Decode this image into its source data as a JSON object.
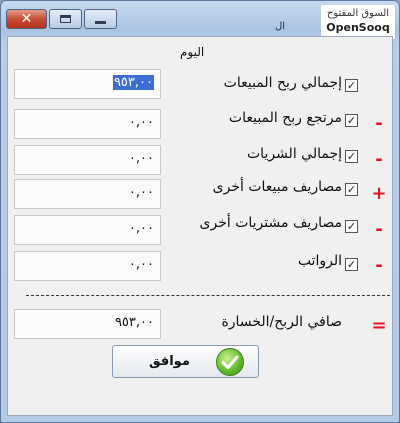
{
  "window": {
    "title": "ال"
  },
  "watermark": {
    "arabic": "السوق المفتوح",
    "english": "OpenSooq"
  },
  "header": {
    "today_label": "اليوم"
  },
  "rows": [
    {
      "label": "إجمالي ربح المبيعات",
      "value": "٩٥٣,٠٠",
      "operator": "",
      "checked": true,
      "selected": true
    },
    {
      "label": "مرتجع ربح المبيعات",
      "value": "٠,٠٠",
      "operator": "-",
      "checked": true
    },
    {
      "label": "إجمالي الشريات",
      "value": "٠,٠٠",
      "operator": "-",
      "checked": true
    },
    {
      "label": "مصاريف مبيعات أخرى",
      "value": "٠,٠٠",
      "operator": "+",
      "checked": true
    },
    {
      "label": "مصاريف مشتريات أخرى",
      "value": "٠,٠٠",
      "operator": "-",
      "checked": true
    },
    {
      "label": "الرواتب",
      "value": "٠,٠٠",
      "operator": "-",
      "checked": true
    }
  ],
  "result": {
    "label": "صافي الربح/الخسارة",
    "value": "٩٥٣,٠٠",
    "operator": "="
  },
  "ok_button": {
    "label": "موافق"
  },
  "icons": {
    "close": "close-icon",
    "restore": "restore-icon",
    "minimize": "minimize-icon",
    "ok": "check-icon"
  },
  "colors": {
    "operator": "#e81224",
    "selection": "#3a6ed0",
    "ok_icon": "#5fb62a"
  }
}
